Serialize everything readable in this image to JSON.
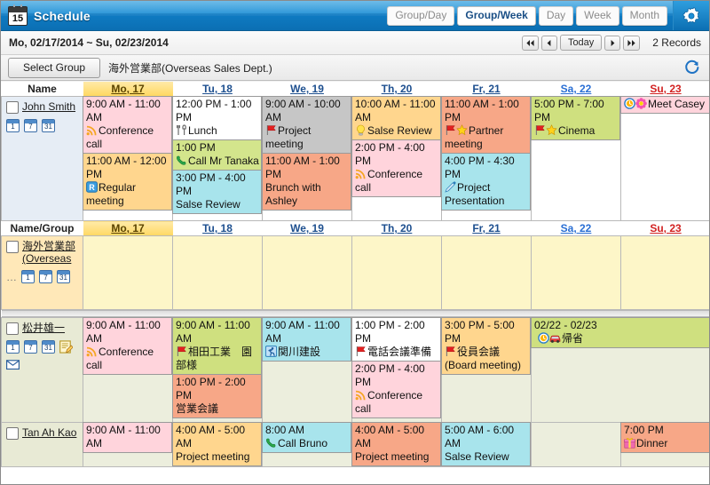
{
  "window": {
    "title": "Schedule",
    "calendar_icon_day": "15"
  },
  "view_tabs": [
    {
      "label": "Group/Day",
      "active": false
    },
    {
      "label": "Group/Week",
      "active": true
    },
    {
      "label": "Day",
      "active": false
    },
    {
      "label": "Week",
      "active": false
    },
    {
      "label": "Month",
      "active": false
    }
  ],
  "settings_icon": "gear-icon",
  "datebar": {
    "range": "Mo, 02/17/2014 ~ Su, 02/23/2014",
    "nav": {
      "first": "◀◀",
      "prev": "◀",
      "today": "Today",
      "next": "▶",
      "last": "▶▶"
    },
    "records": "2 Records"
  },
  "groupbar": {
    "select_group_label": "Select Group",
    "group_name": "海外営業部(Overseas Sales Dept.)",
    "refresh_icon": "refresh-icon"
  },
  "columns": {
    "name_header_1": "Name",
    "name_header_2": "Name/Group",
    "days": [
      {
        "label": "Mo, 17",
        "kind": "today"
      },
      {
        "label": "Tu, 18",
        "kind": "weekday"
      },
      {
        "label": "We, 19",
        "kind": "weekday"
      },
      {
        "label": "Th, 20",
        "kind": "weekday"
      },
      {
        "label": "Fr, 21",
        "kind": "weekday"
      },
      {
        "label": "Sa, 22",
        "kind": "sat"
      },
      {
        "label": "Su, 23",
        "kind": "sun"
      }
    ]
  },
  "rows": [
    {
      "name": "John Smith",
      "name_style": "blue",
      "mini_icons": [
        "1",
        "7",
        "31"
      ],
      "extra_icons": [],
      "cell_tint": "white",
      "days": [
        {
          "events": [
            {
              "time": "9:00 AM - 11:00 AM",
              "title": "Conference call",
              "color": "c-pink",
              "icons": [
                "rss-icon"
              ]
            },
            {
              "time": "11:00 AM - 12:00 PM",
              "title": "Regular meeting",
              "color": "c-orange",
              "icons": [
                "r-badge-icon"
              ]
            }
          ]
        },
        {
          "events": [
            {
              "time": "12:00 PM - 1:00 PM",
              "title": "Lunch",
              "color": "c-white",
              "icons": [
                "cutlery-icon"
              ]
            },
            {
              "time": "1:00 PM",
              "title": "Call Mr Tanaka",
              "color": "c-green",
              "icons": [
                "phone-icon"
              ]
            },
            {
              "time": "3:00 PM - 4:00 PM",
              "title": "Salse Review",
              "color": "c-cyan",
              "icons": []
            }
          ]
        },
        {
          "events": [
            {
              "time": "9:00 AM - 10:00 AM",
              "title": "Project meeting",
              "color": "c-gray",
              "icons": [
                "red-flag-icon"
              ]
            },
            {
              "time": "11:00 AM - 1:00 PM",
              "title": "Brunch with Ashley",
              "color": "c-salmon",
              "icons": []
            }
          ]
        },
        {
          "events": [
            {
              "time": "10:00 AM - 11:00 AM",
              "title": "Salse Review",
              "color": "c-orange",
              "icons": [
                "bulb-icon"
              ]
            },
            {
              "time": "2:00 PM - 4:00 PM",
              "title": "Conference call",
              "color": "c-pink",
              "icons": [
                "rss-icon"
              ]
            }
          ]
        },
        {
          "events": [
            {
              "time": "11:00 AM - 1:00 PM",
              "title": "Partner meeting",
              "color": "c-salmon",
              "icons": [
                "red-flag-icon",
                "star-icon"
              ]
            },
            {
              "time": "4:00 PM - 4:30 PM",
              "title": "Project Presentation",
              "color": "c-cyan",
              "icons": [
                "pen-icon"
              ]
            }
          ]
        },
        {
          "events": [
            {
              "time": "5:00 PM - 7:00 PM",
              "title": "Cinema",
              "color": "c-olive",
              "icons": [
                "red-flag-icon",
                "star-icon"
              ]
            }
          ]
        },
        {
          "events": [
            {
              "time": "",
              "title": "Meet Casey",
              "color": "c-pink",
              "icons": [
                "clock-icon",
                "flower-icon"
              ]
            }
          ]
        }
      ]
    },
    {
      "name": "海外営業部(Overseas",
      "name_style": "group",
      "name_truncated": true,
      "mini_icons": [
        "1",
        "7",
        "31"
      ],
      "extra_icons": [],
      "cell_tint": "yellow",
      "days": [
        {
          "events": []
        },
        {
          "events": []
        },
        {
          "events": []
        },
        {
          "events": []
        },
        {
          "events": []
        },
        {
          "events": []
        },
        {
          "events": []
        }
      ]
    },
    {
      "name": "松井雄一",
      "name_style": "plain",
      "mini_icons": [
        "1",
        "7",
        "31"
      ],
      "extra_icons": [
        "edit-icon",
        "mail-icon"
      ],
      "cell_tint": "beige",
      "days": [
        {
          "events": [
            {
              "time": "9:00 AM - 11:00 AM",
              "title": "Conference call",
              "color": "c-pink",
              "icons": [
                "rss-icon"
              ]
            }
          ]
        },
        {
          "events": [
            {
              "time": "9:00 AM - 11:00 AM",
              "title": "相田工業　園部様",
              "color": "c-olive",
              "icons": [
                "red-flag-icon"
              ]
            },
            {
              "time": "1:00 PM - 2:00 PM",
              "title": "営業会議",
              "color": "c-salmon",
              "icons": []
            }
          ]
        },
        {
          "events": [
            {
              "time": "9:00 AM - 11:00 AM",
              "title": "関川建設",
              "color": "c-cyan",
              "icons": [
                "runner-icon"
              ]
            }
          ]
        },
        {
          "events": [
            {
              "time": "1:00 PM - 2:00 PM",
              "title": "電話会議準備",
              "color": "c-white",
              "icons": [
                "red-flag-icon"
              ]
            },
            {
              "time": "2:00 PM - 4:00 PM",
              "title": "Conference call",
              "color": "c-pink",
              "icons": [
                "rss-icon"
              ]
            }
          ]
        },
        {
          "events": [
            {
              "time": "3:00 PM - 5:00 PM",
              "title": "役員会議(Board meeting)",
              "color": "c-orange",
              "icons": [
                "red-flag-icon"
              ]
            }
          ]
        },
        {
          "events": [
            {
              "time": "02/22 - 02/23",
              "title": "帰省",
              "color": "c-olive",
              "icons": [
                "clock-icon",
                "car-icon"
              ],
              "span": 2
            }
          ]
        },
        {
          "events": []
        }
      ]
    },
    {
      "name": "Tan Ah Kao",
      "name_style": "plain",
      "mini_icons": [],
      "extra_icons": [],
      "cell_tint": "beige",
      "days": [
        {
          "events": [
            {
              "time": "9:00 AM - 11:00 AM",
              "title": "",
              "color": "c-pink",
              "icons": []
            }
          ]
        },
        {
          "events": [
            {
              "time": "4:00 AM - 5:00 AM",
              "title": "Project meeting",
              "color": "c-orange",
              "icons": []
            }
          ]
        },
        {
          "events": [
            {
              "time": "8:00 AM",
              "title": "Call Bruno",
              "color": "c-cyan",
              "icons": [
                "phone-icon"
              ]
            }
          ]
        },
        {
          "events": [
            {
              "time": "4:00 AM - 5:00 AM",
              "title": "Project meeting",
              "color": "c-salmon",
              "icons": []
            }
          ]
        },
        {
          "events": [
            {
              "time": "5:00 AM - 6:00 AM",
              "title": "Salse Review",
              "color": "c-cyan",
              "icons": []
            }
          ]
        },
        {
          "events": []
        },
        {
          "events": [
            {
              "time": "7:00 PM",
              "title": "Dinner",
              "color": "c-salmon",
              "icons": [
                "gift-icon"
              ]
            }
          ]
        }
      ]
    }
  ],
  "colors": {
    "brand_blue": "#0b6fb3",
    "today_yellow": "#ffd862",
    "pink": "#ffd4dc",
    "orange": "#ffd68e",
    "green": "#d3e58c",
    "cyan": "#a8e4ec",
    "gray": "#c6c6c6",
    "salmon": "#f7a787",
    "olive": "#cfe07f"
  }
}
